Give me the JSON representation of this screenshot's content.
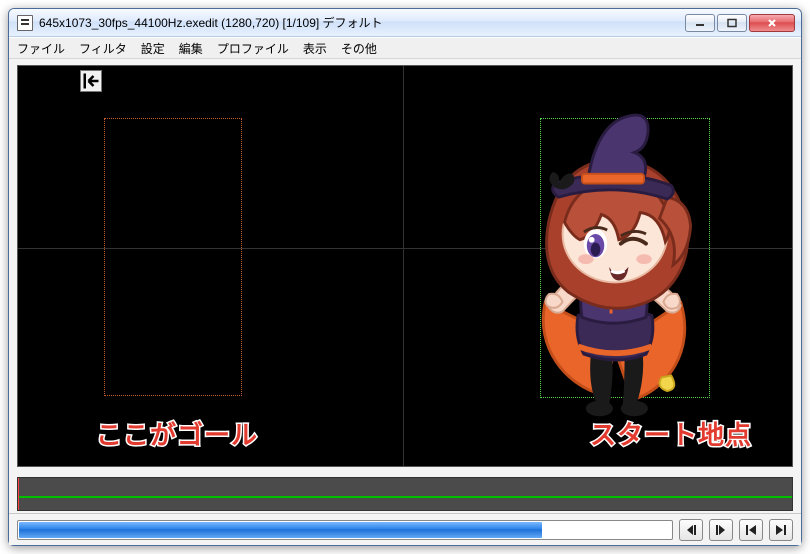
{
  "title": "645x1073_30fps_44100Hz.exedit (1280,720)  [1/109]  デフォルト",
  "menus": [
    "ファイル",
    "フィルタ",
    "設定",
    "編集",
    "プロファイル",
    "表示",
    "その他"
  ],
  "labels": {
    "goal": "ここがゴール",
    "start": "スタート地点"
  },
  "playback": {
    "progress_pct": 80
  },
  "icons": {
    "minimize": "minimize-icon",
    "maximize": "maximize-icon",
    "close": "close-icon",
    "back": "back-to-start-icon",
    "step_back": "step-back-icon",
    "step_fwd": "step-forward-icon",
    "jump_start": "jump-start-icon",
    "jump_end": "jump-end-icon"
  }
}
